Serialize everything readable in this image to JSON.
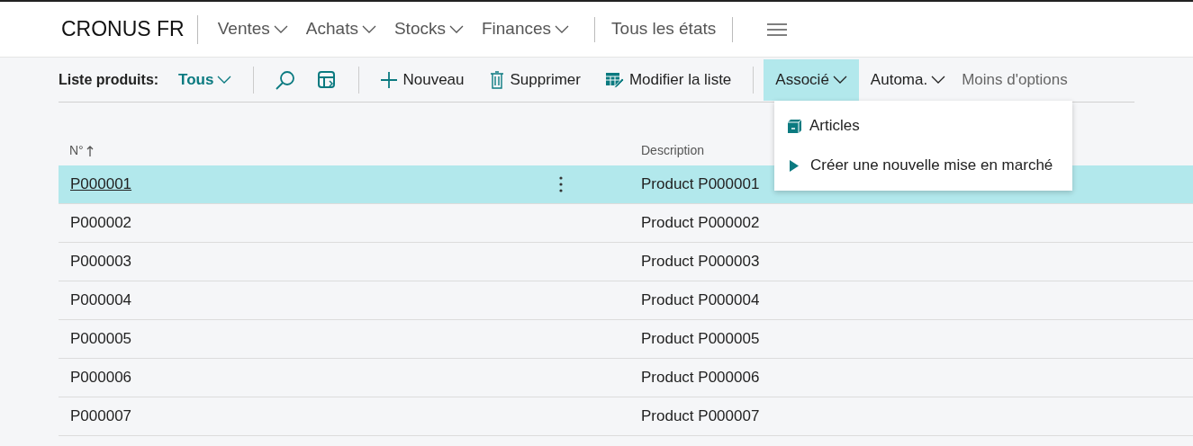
{
  "app": {
    "company": "CRONUS FR"
  },
  "nav": [
    {
      "label": "Ventes",
      "kind": "dropdown"
    },
    {
      "label": "Achats",
      "kind": "dropdown"
    },
    {
      "label": "Stocks",
      "kind": "dropdown"
    },
    {
      "label": "Finances",
      "kind": "dropdown"
    },
    {
      "label": "Tous les états",
      "kind": "link"
    }
  ],
  "toolbar": {
    "list_label": "Liste produits:",
    "view": "Tous",
    "actions": [
      {
        "label": "Nouveau",
        "kind": "new"
      },
      {
        "label": "Supprimer",
        "kind": "delete"
      },
      {
        "label": "Modifier la liste",
        "kind": "edit"
      }
    ],
    "menus": [
      {
        "label": "Associé",
        "expanded": true
      },
      {
        "label": "Automa.",
        "expanded": false
      }
    ],
    "less_options": "Moins d'options"
  },
  "dropdown": [
    {
      "label": "Articles",
      "kind": "box"
    },
    {
      "label": "Créer une nouvelle mise en marché",
      "kind": "play"
    }
  ],
  "table": {
    "columns": [
      "N°",
      "Description"
    ],
    "rows": [
      {
        "no": "P000001",
        "description": "Product P000001",
        "selected": true
      },
      {
        "no": "P000002",
        "description": "Product P000002",
        "selected": false
      },
      {
        "no": "P000003",
        "description": "Product P000003",
        "selected": false
      },
      {
        "no": "P000004",
        "description": "Product P000004",
        "selected": false
      },
      {
        "no": "P000005",
        "description": "Product P000005",
        "selected": false
      },
      {
        "no": "P000006",
        "description": "Product P000006",
        "selected": false
      },
      {
        "no": "P000007",
        "description": "Product P000007",
        "selected": false
      }
    ]
  }
}
